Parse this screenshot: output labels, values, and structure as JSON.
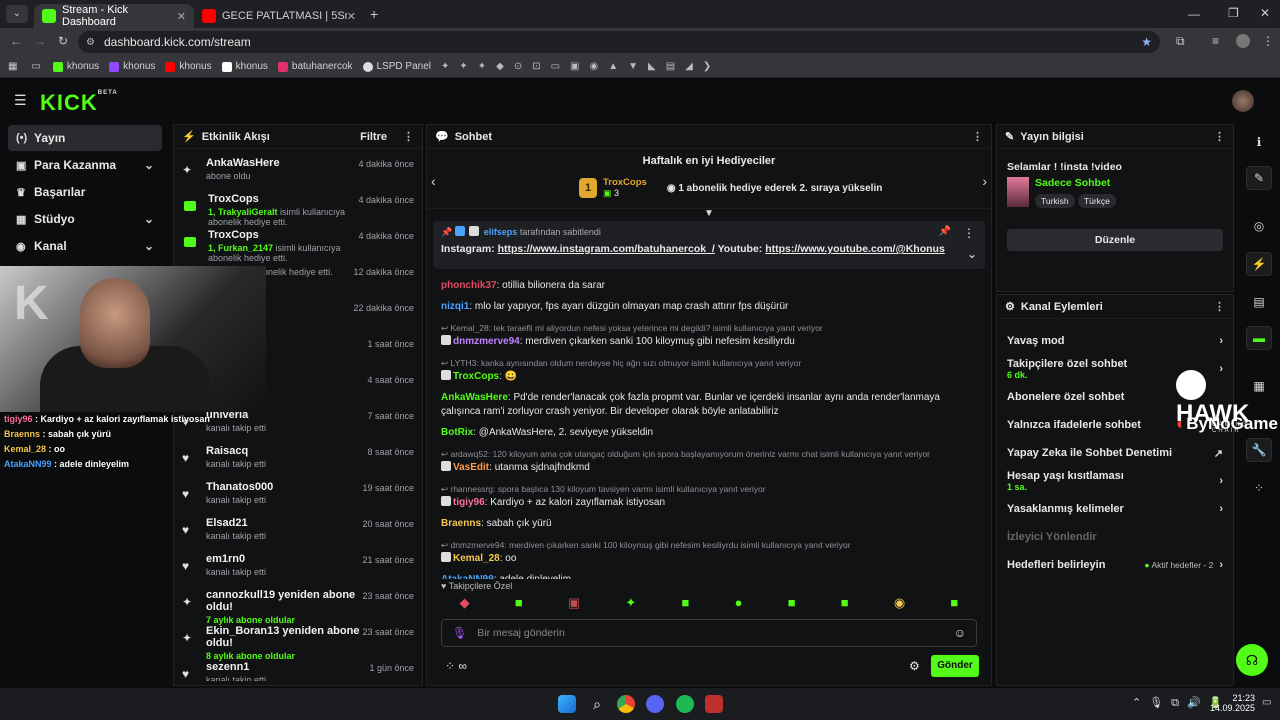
{
  "browser": {
    "tabs": [
      {
        "title": "Stream - Kick Dashboard",
        "active": true,
        "color": "#53fc18"
      },
      {
        "title": "GECE PATLATMASI | 5Sriders | M",
        "active": false,
        "color": "#ff0000"
      }
    ],
    "url": "dashboard.kick.com/stream",
    "bookmarks": [
      "khonus",
      "khonus",
      "khonus",
      "khonus",
      "batuhanercok",
      "LSPD Panel"
    ]
  },
  "sidebar": {
    "items": [
      {
        "label": "Yayın",
        "icon": "(•)",
        "active": true
      },
      {
        "label": "Para Kazanma",
        "icon": "▣",
        "chev": true
      },
      {
        "label": "Başarılar",
        "icon": "🏆",
        "chev": false
      },
      {
        "label": "Stüdyo",
        "icon": "▦",
        "chev": true
      },
      {
        "label": "Kanal",
        "icon": "◉",
        "chev": true
      }
    ]
  },
  "activity": {
    "title": "Etkinlik Akışı",
    "filter": "Filtre",
    "items": [
      {
        "name": "AnkaWasHere",
        "sub": "abone oldu",
        "time": "4 dakika önce",
        "type": "sub"
      },
      {
        "name": "TroxCops",
        "highlight": "1, TrakyaliGeralt",
        "sub": " isimli kullanıcıya abonelik hediye etti.",
        "time": "4 dakika önce",
        "type": "gift"
      },
      {
        "name": "TroxCops",
        "highlight": "1, Furkan_2147",
        "sub": " isimli kullanıcıya abonelik hediye etti.",
        "time": "4 dakika önce",
        "type": "gift"
      },
      {
        "name": "",
        "sub": "kullanıcıya abonelik hediye etti.",
        "time": "12 dakika önce",
        "type": "gift"
      },
      {
        "name": "",
        "sub": "",
        "time": "22 dakika önce",
        "type": "sub"
      },
      {
        "name": "nl",
        "sub": "",
        "time": "1 saat önce",
        "type": "follow"
      },
      {
        "name": "",
        "sub": "",
        "time": "4 saat önce",
        "type": "follow"
      },
      {
        "name": "univeria",
        "sub": "kanalı takip etti",
        "time": "7 saat önce",
        "type": "follow"
      },
      {
        "name": "Raisacq",
        "sub": "kanalı takip etti",
        "time": "8 saat önce",
        "type": "follow"
      },
      {
        "name": "Thanatos000",
        "sub": "kanalı takip etti",
        "time": "19 saat önce",
        "type": "follow"
      },
      {
        "name": "Elsad21",
        "sub": "kanalı takip etti",
        "time": "20 saat önce",
        "type": "follow"
      },
      {
        "name": "em1rn0",
        "sub": "kanalı takip etti",
        "time": "21 saat önce",
        "type": "follow"
      },
      {
        "name": "cannozkull19 yeniden abone oldu!",
        "highlight": "7 aylık abone oldular",
        "sub": "",
        "time": "23 saat önce",
        "type": "sub"
      },
      {
        "name": "Ekin_Boran13 yeniden abone oldu!",
        "highlight": "8 aylık abone oldular",
        "sub": "",
        "time": "23 saat önce",
        "type": "sub"
      },
      {
        "name": "sezenn1",
        "sub": "kanalı takip etti",
        "time": "1 gün önce",
        "type": "follow"
      }
    ]
  },
  "chat": {
    "title": "Sohbet",
    "gifters_title": "Haftalık en iyi Hediyeciler",
    "top_gifter": "TroxCops",
    "top_gifter_count": "3",
    "rank": "1",
    "gift_hint": "1 abonelik hediye ederek 2. sıraya yükselin",
    "pinned_by": "elifseps",
    "pinned_suffix": "tarafından sabitlendi",
    "pinned_text_1": "Instagram: ",
    "pinned_link_1": "https://www.instagram.com/batuhanercok_/",
    "pinned_text_2": " Youtube: ",
    "pinned_link_2": "https://www.youtube.com/@Khonus",
    "messages": [
      {
        "user": "phonchik37",
        "color": "#e54a64",
        "text": ": otillia bilionera da sarar"
      },
      {
        "user": "nizqi1",
        "color": "#4aa3ff",
        "text": ": mlo lar yapıyor, fps ayarı düzgün olmayan map crash attırır fps düşürür"
      },
      {
        "reply": "Kemal_28: tek taraefli mi aliyordun nefesi yoksa yeterince mi degildi? isimli kullanıcıya yanıt veriyor",
        "user": "dnmzmerve94",
        "color": "#c084fc",
        "text": ": merdiven çıkarken sanki 100 kiloymuş gibi nefesim kesiliyrdu"
      },
      {
        "reply": "LYTH3: kanka aynısından oldum nerdeyse hiç ağrı sızı olmuyor isimli kullanıcıya yanıt veriyor",
        "user": "TroxCops",
        "color": "#53fc18",
        "text": ": 😀"
      },
      {
        "user": "AnkaWasHere",
        "color": "#53fc18",
        "text": ": Pd'de render'lanacak çok fazla propmt var. Bunlar ve içerdeki insanlar aynı anda render'lanmaya çalışınca ram'i zorluyor crash yeniyor. Bir developer olarak böyle anlatabiliriz"
      },
      {
        "user": "BotRix",
        "color": "#53fc18",
        "text": ": @AnkaWasHere, 2. seviyeye yükseldin"
      },
      {
        "reply": "ardawq52: 120 kiloyum ama çok utangaç olduğum için spora başlayamıyorum öneriniz varmı chat isimli kullanıcıya yanıt veriyor",
        "user": "VasEdit",
        "color": "#ff9a4a",
        "text": ": utanma sjdnajfndkmd"
      },
      {
        "reply": "rhannessrg: spora başlıca 130 kiloyum tavsiyen varmı isimli kullanıcıya yanıt veriyor",
        "user": "tigiy96",
        "color": "#ff6fa0",
        "text": ": Kardiyo + az kalori zayıflamak istiyosan"
      },
      {
        "user": "Braenns",
        "color": "#f5c84a",
        "text": ": sabah çık yürü"
      },
      {
        "reply": "dnmzmerve94: merdiven çıkarken sanki 100 kiloymuş gibi nefesim kesiliyrdu isimli kullanıcıya yanıt veriyor",
        "user": "Kemal_28",
        "color": "#f5c84a",
        "text": ": oo"
      },
      {
        "user": "AtakaNN99",
        "color": "#4aa3ff",
        "text": ": adele dinleyelim"
      }
    ],
    "followers_only": "Takipçilere Özel",
    "input_placeholder": "Bir mesaj gönderin",
    "send": "Gönder"
  },
  "stream_info": {
    "title": "Yayın bilgisi",
    "stream_title": "Selamlar ! !insta !video",
    "category": "Sadece Sohbet",
    "tags": [
      "Turkish",
      "Türkçe"
    ],
    "edit": "Düzenle"
  },
  "channel_actions": {
    "title": "Kanal Eylemleri",
    "items": [
      {
        "label": "Yavaş mod",
        "sub": "",
        "arrow": "›"
      },
      {
        "label": "Takipçilere özel sohbet",
        "sub": "6 dk.",
        "arrow": "›"
      },
      {
        "label": "Abonelere özel sohbet",
        "sub": "",
        "arrow": ""
      },
      {
        "label": "Yalnızca ifadelerle sohbet",
        "sub": "",
        "arrow": ""
      },
      {
        "label": "Yapay Zeka ile Sohbet Denetimi",
        "sub": "",
        "arrow": "↗"
      },
      {
        "label": "Hesap yaşı kısıtlaması",
        "sub": "1 sa.",
        "arrow": "›"
      },
      {
        "label": "Yasaklanmış kelimeler",
        "sub": "",
        "arrow": "›"
      },
      {
        "label": "İzleyici Yönlendir",
        "sub": "",
        "arrow": "",
        "dim": true
      },
      {
        "label": "Hedefleri belirleyin",
        "sub": "",
        "arrow": "›",
        "extra": "Aktif hedefler - 2"
      }
    ]
  },
  "overlay": {
    "brand1": "HAWK",
    "brand1_sub": "GAMING CHAIR",
    "brand2": "ByNoGame",
    "chat": [
      {
        "user": "tigiy96",
        "text": " : Kardiyo + az kalori zayıflamak istiyosan"
      },
      {
        "user": "Braenns",
        "text": " : sabah çık yürü"
      },
      {
        "user": "Kemal_28",
        "text": " : oo"
      },
      {
        "user": "AtakaNN99",
        "text": " : adele dinleyelim"
      }
    ]
  },
  "taskbar": {
    "time": "21:23",
    "date": "14.09.2025"
  }
}
